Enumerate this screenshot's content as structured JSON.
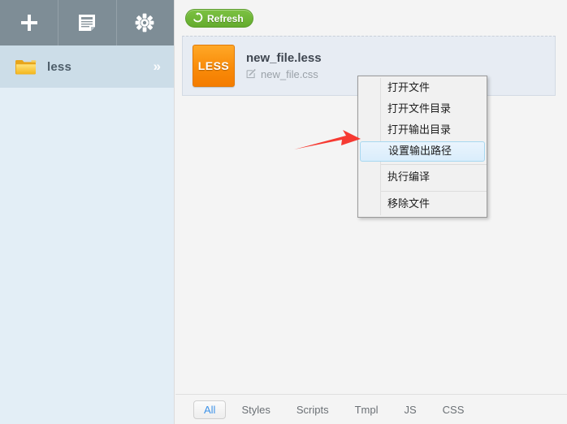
{
  "sidebar": {
    "toolbar": [
      {
        "name": "add-button",
        "icon": "plus-icon",
        "label": "+"
      },
      {
        "name": "files-button",
        "icon": "document-icon",
        "label": ""
      },
      {
        "name": "settings-button",
        "icon": "gear-icon",
        "label": ""
      }
    ],
    "project": {
      "label": "less",
      "icon": "folder-icon",
      "expand": "»"
    }
  },
  "main": {
    "refresh": {
      "label": "Refresh",
      "icon": "refresh-icon",
      "color": "#6fb539"
    },
    "files": [
      {
        "badge": "LESS",
        "badge_color": "#f98b09",
        "name": "new_file.less",
        "output": "new_file.css",
        "output_icon": "edit-icon"
      }
    ],
    "filters": [
      {
        "label": "All",
        "active": true
      },
      {
        "label": "Styles",
        "active": false
      },
      {
        "label": "Scripts",
        "active": false
      },
      {
        "label": "Tmpl",
        "active": false
      },
      {
        "label": "JS",
        "active": false
      },
      {
        "label": "CSS",
        "active": false
      }
    ]
  },
  "context_menu": {
    "items": [
      {
        "label": "打开文件",
        "selected": false,
        "separator_after": false
      },
      {
        "label": "打开文件目录",
        "selected": false,
        "separator_after": false
      },
      {
        "label": "打开输出目录",
        "selected": false,
        "separator_after": false
      },
      {
        "label": "设置输出路径",
        "selected": true,
        "separator_after": true
      },
      {
        "label": "执行编译",
        "selected": false,
        "separator_after": true
      },
      {
        "label": "移除文件",
        "selected": false,
        "separator_after": false
      }
    ]
  },
  "annotation": {
    "arrow": "red-arrow",
    "color": "#f63a32"
  }
}
